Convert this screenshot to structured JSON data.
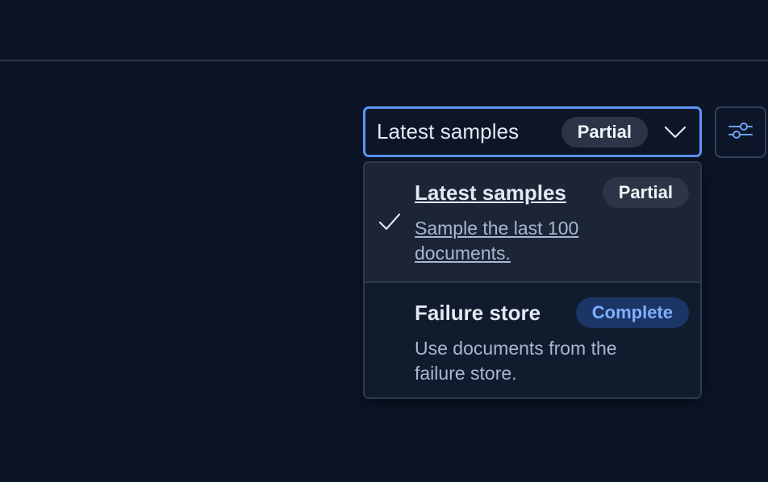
{
  "select": {
    "selected_label": "Latest samples",
    "selected_badge": "Partial"
  },
  "options": [
    {
      "title": "Latest samples",
      "badge": "Partial",
      "description": "Sample the last 100 documents.",
      "selected": true
    },
    {
      "title": "Failure store",
      "badge": "Complete",
      "description": "Use documents from the failure store.",
      "selected": false
    }
  ],
  "icons": {
    "chevron": "chevron-down-icon",
    "check": "check-icon",
    "settings": "sliders-icon"
  },
  "colors": {
    "background": "#0c1427",
    "focus_border": "#5c95f5",
    "badge_default_bg": "#2b3547",
    "badge_primary_bg": "#1a3566",
    "badge_primary_text": "#7fb0ff"
  }
}
